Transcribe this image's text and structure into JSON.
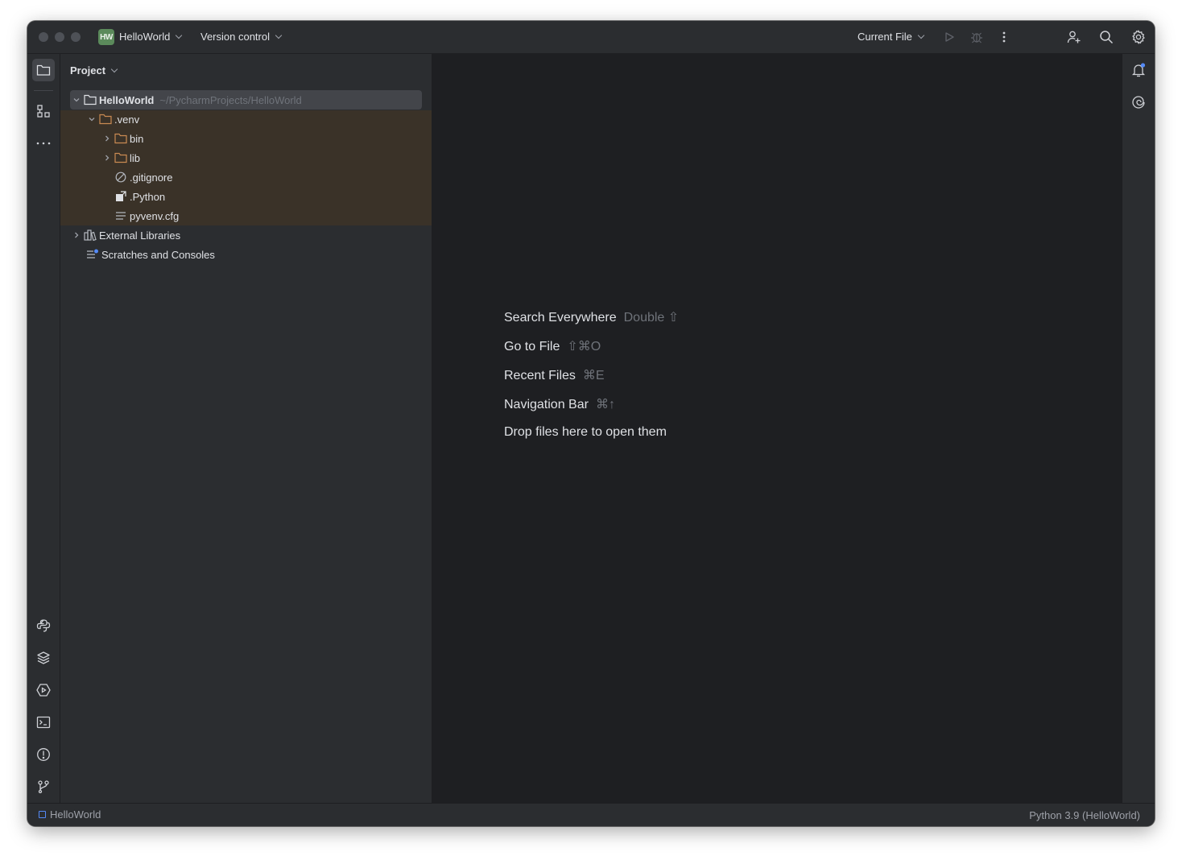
{
  "titlebar": {
    "project_badge": "HW",
    "project_name": "HelloWorld",
    "vcs": "Version control",
    "run_config": "Current File"
  },
  "project_panel": {
    "title": "Project",
    "tree": [
      {
        "label": "HelloWorld",
        "path": "~/PycharmProjects/HelloWorld"
      },
      {
        "label": ".venv"
      },
      {
        "label": "bin"
      },
      {
        "label": "lib"
      },
      {
        "label": ".gitignore"
      },
      {
        "label": ".Python"
      },
      {
        "label": "pyvenv.cfg"
      },
      {
        "label": "External Libraries"
      },
      {
        "label": "Scratches and Consoles"
      }
    ]
  },
  "editor": {
    "hints": [
      {
        "label": "Search Everywhere",
        "shortcut": "Double ⇧"
      },
      {
        "label": "Go to File",
        "shortcut": "⇧⌘O"
      },
      {
        "label": "Recent Files",
        "shortcut": "⌘E"
      },
      {
        "label": "Navigation Bar",
        "shortcut": "⌘↑"
      },
      {
        "label": "Drop files here to open them",
        "shortcut": ""
      }
    ]
  },
  "statusbar": {
    "project": "HelloWorld",
    "interpreter": "Python 3.9 (HelloWorld)"
  },
  "colors": {
    "accent": "#548af7",
    "venv_highlight": "#3a3228",
    "folder": "#b4b8bf"
  }
}
